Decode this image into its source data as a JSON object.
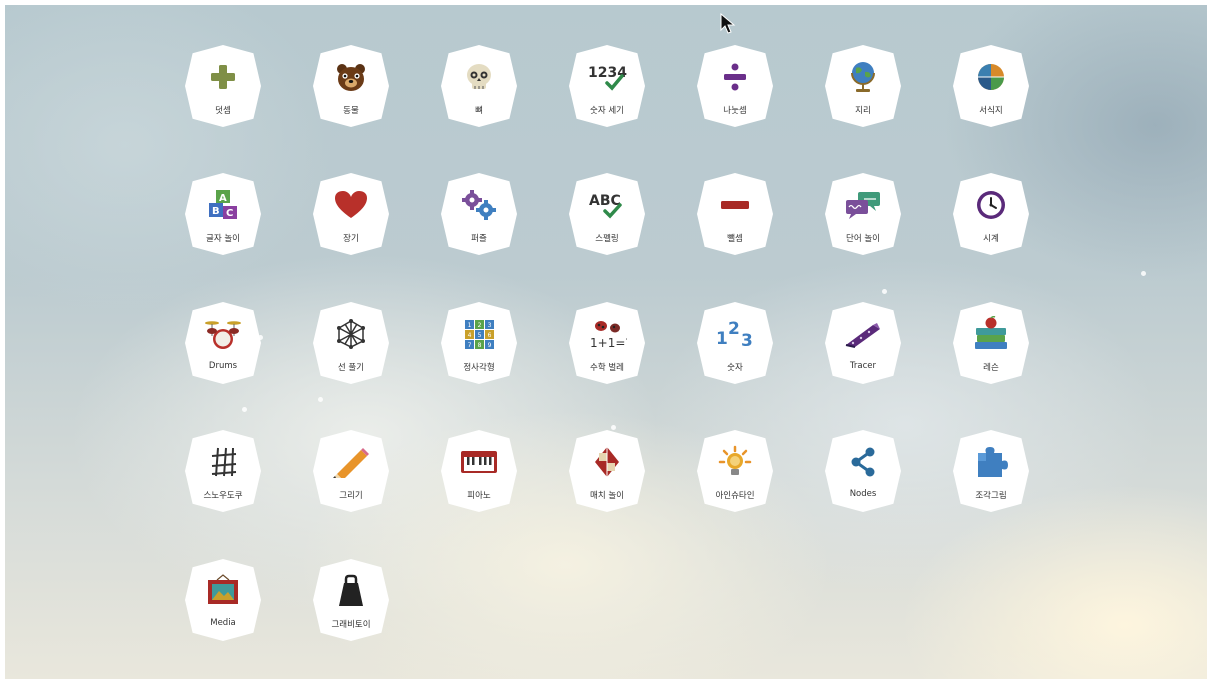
{
  "launcher": {
    "items": [
      {
        "label": "덧셈",
        "icon": "plus-icon"
      },
      {
        "label": "동물",
        "icon": "bear-icon"
      },
      {
        "label": "뼈",
        "icon": "skull-icon"
      },
      {
        "label": "숫자 세기",
        "icon": "numbers-check-icon"
      },
      {
        "label": "나눗셈",
        "icon": "divide-icon"
      },
      {
        "label": "지리",
        "icon": "globe-icon"
      },
      {
        "label": "서식지",
        "icon": "habitat-icon"
      },
      {
        "label": "글자 놀이",
        "icon": "letter-blocks-icon"
      },
      {
        "label": "장기",
        "icon": "heart-icon"
      },
      {
        "label": "퍼즐",
        "icon": "gears-icon"
      },
      {
        "label": "스펠링",
        "icon": "abc-check-icon"
      },
      {
        "label": "뺄셈",
        "icon": "minus-icon"
      },
      {
        "label": "단어 놀이",
        "icon": "speech-bubbles-icon"
      },
      {
        "label": "시계",
        "icon": "clock-icon"
      },
      {
        "label": "Drums",
        "icon": "drums-icon"
      },
      {
        "label": "선 풀기",
        "icon": "line-web-icon"
      },
      {
        "label": "정사각형",
        "icon": "number-grid-icon"
      },
      {
        "label": "수학 벌레",
        "icon": "ladybug-math-icon"
      },
      {
        "label": "숫자",
        "icon": "one-two-three-icon"
      },
      {
        "label": "Tracer",
        "icon": "tracer-icon"
      },
      {
        "label": "레슨",
        "icon": "books-apple-icon"
      },
      {
        "label": "스노우도쿠",
        "icon": "sudoku-grid-icon"
      },
      {
        "label": "그리기",
        "icon": "pencil-icon"
      },
      {
        "label": "피아노",
        "icon": "piano-icon"
      },
      {
        "label": "매치 놀이",
        "icon": "match-cards-icon"
      },
      {
        "label": "아인슈타인",
        "icon": "lightbulb-icon"
      },
      {
        "label": "Nodes",
        "icon": "share-nodes-icon"
      },
      {
        "label": "조각그림",
        "icon": "puzzle-piece-icon"
      },
      {
        "label": "Media",
        "icon": "picture-frame-icon"
      },
      {
        "label": "그래비토이",
        "icon": "weight-icon"
      }
    ]
  }
}
